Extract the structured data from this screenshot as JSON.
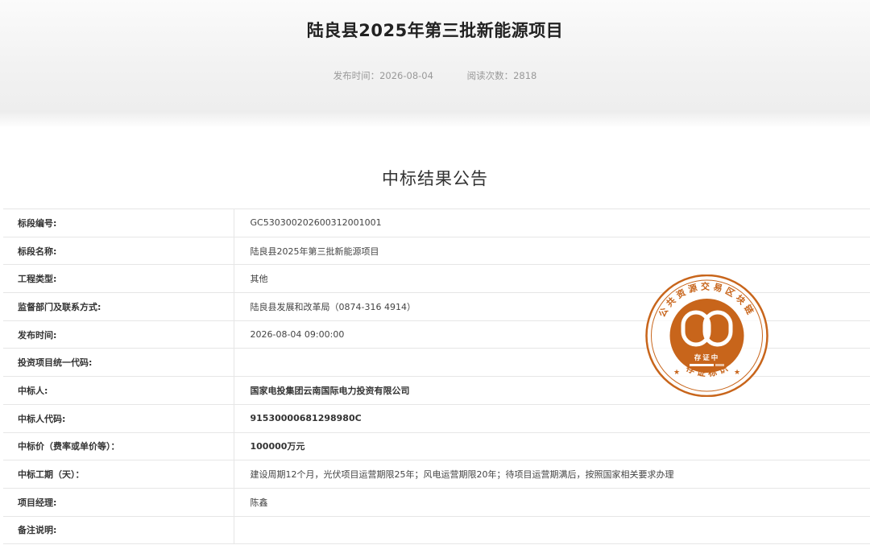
{
  "header": {
    "title": "陆良县2025年第三批新能源项目",
    "publish_time": "发布时间：2026-08-04",
    "read_count": "阅读次数：2818"
  },
  "notice_title": "中标结果公告",
  "rows": [
    {
      "label": "标段编号:",
      "value": "GC5303002026003120​01001"
    },
    {
      "label": "标段名称:",
      "value": "陆良县2025年第三批新能源项目"
    },
    {
      "label": "工程类型:",
      "value": "其他"
    },
    {
      "label": "监督部门及联系方式:",
      "value": "陆良县发展和改革局（0874-316 4914）"
    },
    {
      "label": "发布时间:",
      "value": "2026-08-04 09:00:00"
    },
    {
      "label": "投资项目统一代码:",
      "value": ""
    },
    {
      "label": "中标人:",
      "value": "国家电投集团云南国际电力投资有限公司"
    },
    {
      "label": "中标人代码:",
      "value": "91530000681298980C"
    },
    {
      "label": "中标价（费率或单价等）：",
      "value": "100000万元"
    },
    {
      "label": "中标工期（天）：",
      "value": "建设周期12个月，光伏项目运营期限25年；风电运营期限20年；待项目运营期满后，按照国家相关要求办理"
    },
    {
      "label": "项目经理:",
      "value": "陈鑫"
    },
    {
      "label": "备注说明:",
      "value": ""
    }
  ],
  "seal": {
    "ring_text": "公共资源交易区块链",
    "center_text": "存证中",
    "bottom_text": "存 证 标 识",
    "color": "#c8651b"
  }
}
